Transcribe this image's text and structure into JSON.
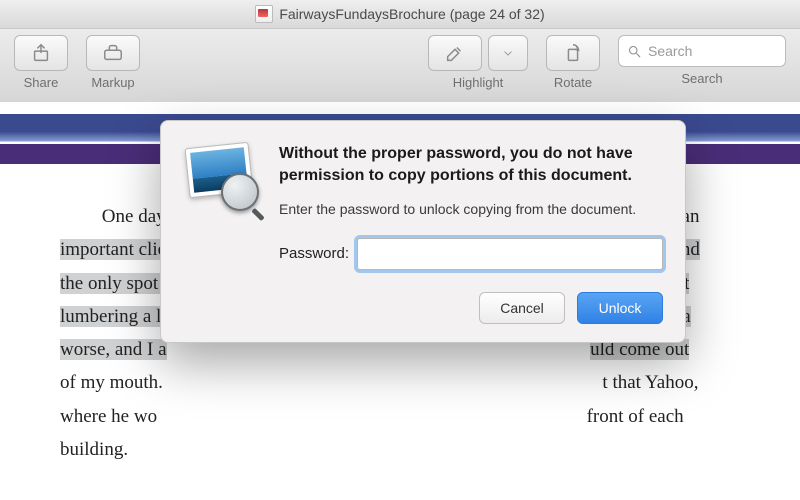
{
  "titlebar": {
    "title": "FairwaysFundaysBrochure (page 24 of 32)"
  },
  "toolbar": {
    "share_label": "Share",
    "markup_label": "Markup",
    "highlight_label": "Highlight",
    "rotate_label": "Rotate",
    "search_label": "Search",
    "search_placeholder": "Search"
  },
  "document": {
    "line1_pre": "One day, a",
    "line1_post": "h to make an",
    "line2_pre": "important clie",
    "line2_post": "problem, and",
    "line3_pre": "the only spot ",
    "line3_post": "reality meant",
    "line4_pre": "lumbering a l",
    "line4_post": "e my nausea",
    "line5_pre": "worse, and I a",
    "line5_post": "uld come out",
    "line6_pre": "of my mouth.",
    "line6_post": "t that Yahoo,",
    "line7_pre": "where he wo",
    "line7_post": "front of each",
    "line8": "building."
  },
  "dialog": {
    "heading": "Without the proper password, you do not have permission to copy portions of this document.",
    "subtext": "Enter the password to unlock copying from the document.",
    "password_label": "Password:",
    "password_value": "",
    "cancel_label": "Cancel",
    "unlock_label": "Unlock"
  }
}
